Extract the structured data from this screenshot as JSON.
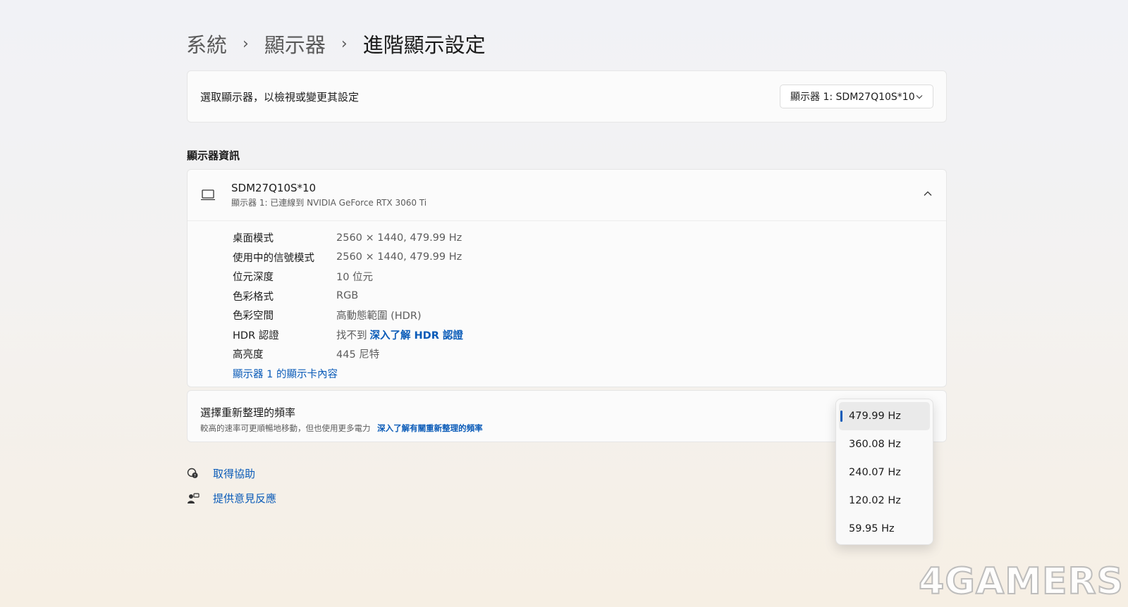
{
  "breadcrumb": {
    "items": [
      "系統",
      "顯示器"
    ],
    "current": "進階顯示設定",
    "separator": "›"
  },
  "select_display": {
    "label": "選取顯示器，以檢視或變更其設定",
    "value": "顯示器 1: SDM27Q10S*10"
  },
  "section_title": "顯示器資訊",
  "display_info": {
    "name": "SDM27Q10S*10",
    "subtitle": "顯示器 1: 已連線到 NVIDIA GeForce RTX 3060 Ti",
    "properties": [
      {
        "key": "桌面模式",
        "value": "2560 × 1440, 479.99 Hz"
      },
      {
        "key": "使用中的信號模式",
        "value": "2560 × 1440, 479.99 Hz"
      },
      {
        "key": "位元深度",
        "value": "10 位元"
      },
      {
        "key": "色彩格式",
        "value": "RGB"
      },
      {
        "key": "色彩空間",
        "value": "高動態範圍 (HDR)"
      },
      {
        "key": "HDR 認證",
        "value": "找不到",
        "link": "深入了解 HDR 認證"
      },
      {
        "key": "高亮度",
        "value": "445 尼特"
      }
    ],
    "adapter_link": "顯示器 1 的顯示卡內容"
  },
  "refresh_rate": {
    "title": "選擇重新整理的頻率",
    "description": "較高的速率可更順暢地移動，但也使用更多電力",
    "link": "深入了解有關重新整理的頻率",
    "options": [
      "479.99 Hz",
      "360.08 Hz",
      "240.07 Hz",
      "120.02 Hz",
      "59.95 Hz"
    ],
    "selected": "479.99 Hz"
  },
  "help_links": {
    "get_help": "取得協助",
    "feedback": "提供意見反應"
  },
  "watermark": "4GAMERS",
  "colors": {
    "accent": "#0a5bb8"
  }
}
